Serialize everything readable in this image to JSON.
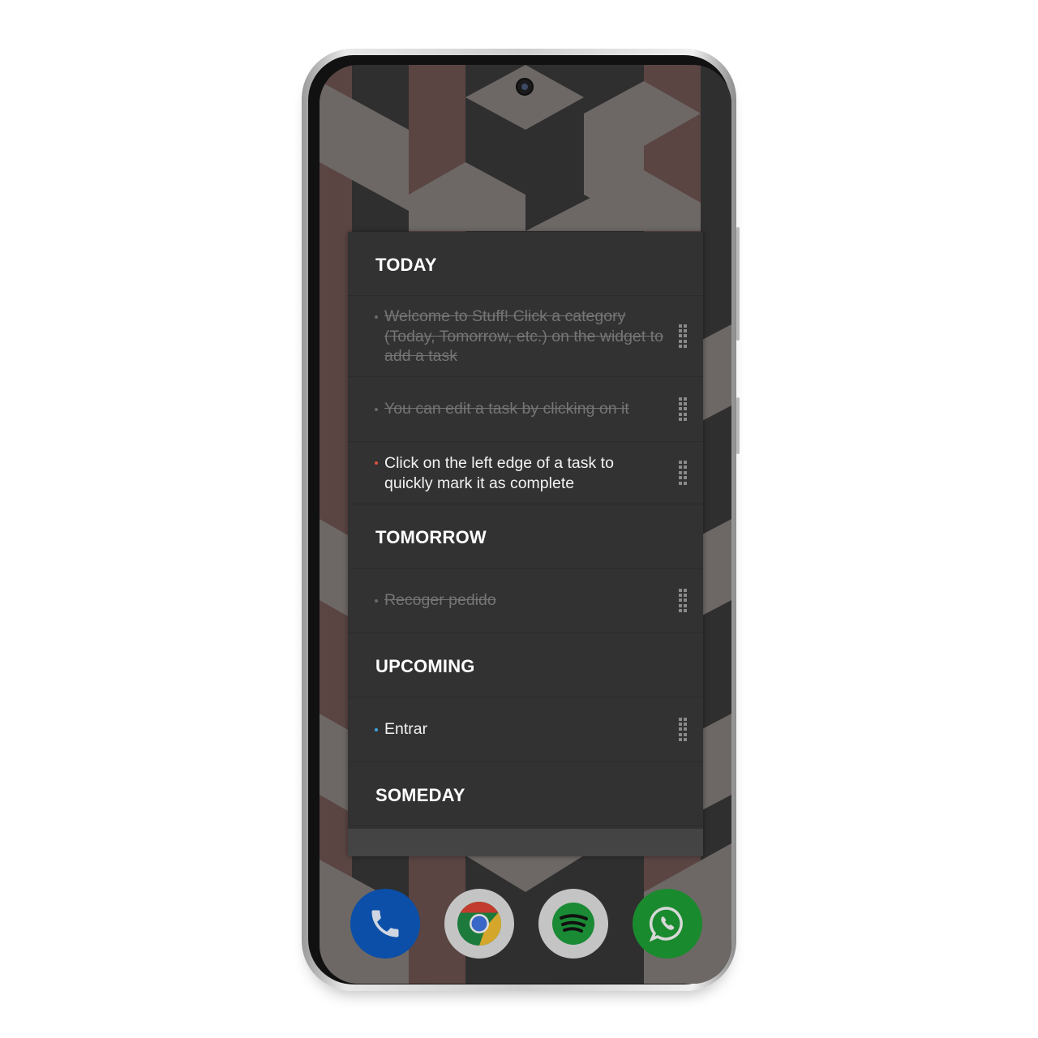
{
  "widget": {
    "sections": [
      {
        "title": "TODAY",
        "tasks": [
          {
            "text": "Welcome to Stuff! Click a category (Today, Tomorrow, etc.) on the widget to add a task",
            "completed": true,
            "bullet_color": "#6a6a6a"
          },
          {
            "text": "You can edit a task by clicking on it",
            "completed": true,
            "bullet_color": "#6a6a6a"
          },
          {
            "text": "Click on the left edge of a task to quickly mark it as complete",
            "completed": false,
            "bullet_color": "#e0533f"
          }
        ]
      },
      {
        "title": "TOMORROW",
        "tasks": [
          {
            "text": "Recoger pedido",
            "completed": true,
            "bullet_color": "#6a6a6a"
          }
        ]
      },
      {
        "title": "UPCOMING",
        "tasks": [
          {
            "text": "Entrar",
            "completed": false,
            "bullet_color": "#3aa6dd"
          }
        ]
      },
      {
        "title": "SOMEDAY",
        "tasks": []
      }
    ]
  },
  "dock": [
    {
      "app": "Phone",
      "icon": "phone-icon",
      "color": "#0b4fa8"
    },
    {
      "app": "Chrome",
      "icon": "chrome-icon",
      "color": "#c9c9c9"
    },
    {
      "app": "Spotify",
      "icon": "spotify-icon",
      "color": "#c9c9c9"
    },
    {
      "app": "WhatsApp",
      "icon": "whatsapp-icon",
      "color": "#1a8a2e"
    }
  ]
}
